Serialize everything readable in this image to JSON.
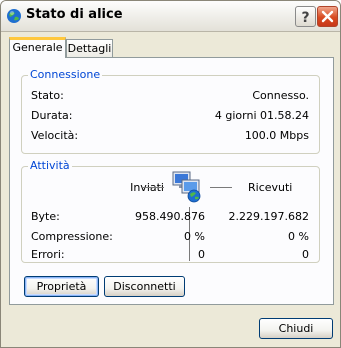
{
  "window": {
    "title": "Stato di alice",
    "icons": {
      "app": "network-globe-icon",
      "help": "help-icon",
      "close": "close-icon"
    },
    "close_color": "#d84a20"
  },
  "tabs": [
    {
      "label": "Generale",
      "active": true
    },
    {
      "label": "Dettagli",
      "active": false
    }
  ],
  "connection": {
    "title": "Connessione",
    "rows": [
      {
        "label": "Stato:",
        "value": "Connesso."
      },
      {
        "label": "Durata:",
        "value": "4 giorni 01.58.24"
      },
      {
        "label": "Velocità:",
        "value": "100.0 Mbps"
      }
    ]
  },
  "activity": {
    "title": "Attività",
    "sent_label": "Inviati",
    "received_label": "Ricevuti",
    "icon": "network-activity-icon",
    "rows": [
      {
        "label": "Byte:",
        "sent": "958.490.876",
        "received": "2.229.197.682"
      },
      {
        "label": "Compressione:",
        "sent": "0 %",
        "received": "0 %"
      },
      {
        "label": "Errori:",
        "sent": "0",
        "received": "0"
      }
    ]
  },
  "buttons": {
    "properties": "Proprietà",
    "disconnect": "Disconnetti",
    "close": "Chiudi"
  }
}
